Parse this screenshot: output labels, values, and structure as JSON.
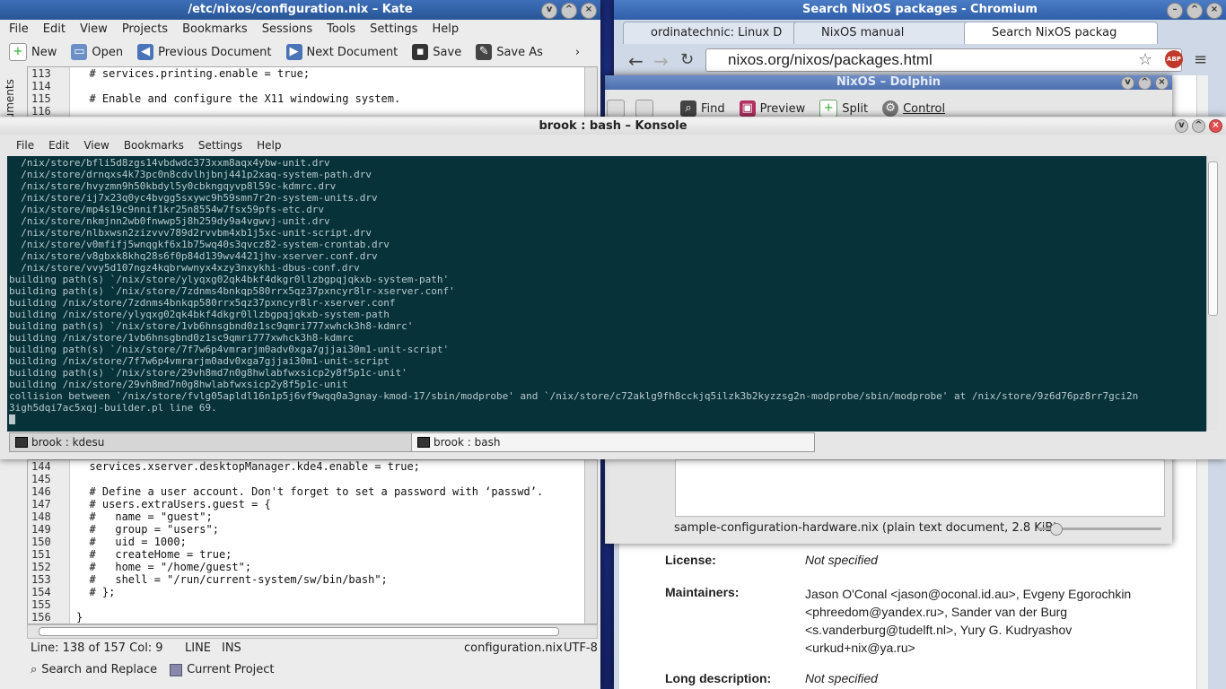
{
  "kate": {
    "title": "/etc/nixos/configuration.nix – Kate",
    "menu": [
      "File",
      "Edit",
      "View",
      "Projects",
      "Bookmarks",
      "Sessions",
      "Tools",
      "Settings",
      "Help"
    ],
    "toolbar": {
      "new": "New",
      "open": "Open",
      "prev": "Previous Document",
      "next": "Next Document",
      "save": "Save",
      "saveas": "Save As"
    },
    "side_label": "cuments",
    "top_lines": [
      {
        "n": "113",
        "t": "  # services.printing.enable = true;"
      },
      {
        "n": "114",
        "t": ""
      },
      {
        "n": "115",
        "t": "  # Enable and configure the X11 windowing system."
      },
      {
        "n": "116",
        "t": ""
      }
    ],
    "bottom_lines": [
      {
        "n": "144",
        "t": "  services.xserver.desktopManager.kde4.enable = true;"
      },
      {
        "n": "145",
        "t": ""
      },
      {
        "n": "146",
        "t": "  # Define a user account. Don't forget to set a password with ‘passwd’."
      },
      {
        "n": "147",
        "t": "  # users.extraUsers.guest = {"
      },
      {
        "n": "148",
        "t": "  #   name = \"guest\";"
      },
      {
        "n": "149",
        "t": "  #   group = \"users\";"
      },
      {
        "n": "150",
        "t": "  #   uid = 1000;"
      },
      {
        "n": "151",
        "t": "  #   createHome = true;"
      },
      {
        "n": "152",
        "t": "  #   home = \"/home/guest\";"
      },
      {
        "n": "153",
        "t": "  #   shell = \"/run/current-system/sw/bin/bash\";"
      },
      {
        "n": "154",
        "t": "  # };"
      },
      {
        "n": "155",
        "t": ""
      },
      {
        "n": "156",
        "t": "}"
      }
    ],
    "status": {
      "pos": "Line: 138 of 157 Col: 9",
      "mode": "LINE",
      "ins": "INS",
      "file": "configuration.nix",
      "enc": "UTF-8"
    },
    "bottom_tabs": {
      "search": "Search and Replace",
      "project": "Current Project"
    }
  },
  "chrome": {
    "title": "Search NixOS packages - Chromium",
    "tabs": [
      "ordinatechnic: Linux D",
      "NixOS manual",
      "Search NixOS packag"
    ],
    "url": "nixos.org/nixos/packages.html",
    "abp": "ABP",
    "license_label": "License:",
    "license_value": "Not specified",
    "maintainers_label": "Maintainers:",
    "maintainers": [
      "Jason O'Conal <jason@oconal.id.au>, Evgeny Egorochkin",
      "<phreedom@yandex.ru>, Sander van der Burg",
      "<s.vanderburg@tudelft.nl>, Yury G. Kudryashov",
      "<urkud+nix@ya.ru>"
    ],
    "longdesc_label": "Long description:",
    "longdesc_value": "Not specified"
  },
  "dolphin": {
    "title": "NixOS – Dolphin",
    "toolbar": {
      "find": "Find",
      "preview": "Preview",
      "split": "Split",
      "control": "Control"
    },
    "status": "sample-configuration-hardware.nix (plain text document, 2.8 KiB)"
  },
  "konsole": {
    "title": "brook : bash – Konsole",
    "menu": [
      "File",
      "Edit",
      "View",
      "Bookmarks",
      "Settings",
      "Help"
    ],
    "lines": [
      "  /nix/store/bfli5d8zgs14vbdwdc373xxm8aqx4ybw-unit.drv",
      "  /nix/store/drnqxs4k73pc0n8cdvlhjbnj441p2xaq-system-path.drv",
      "  /nix/store/hvyzmn9h50kbdyl5y0cbkngqyvp8l59c-kdmrc.drv",
      "  /nix/store/ij7x23q0yc4bvgg5sxywc9h59smn7r2n-system-units.drv",
      "  /nix/store/mp4s19c9nnif1kr25n8554w7fsx59pfs-etc.drv",
      "  /nix/store/nkmjnn2wb0fnwwp5j8h259dy9a4vgwvj-unit.drv",
      "  /nix/store/nlbxwsn2zizvvv789d2rvvbm4xb1j5xc-unit-script.drv",
      "  /nix/store/v0mfifj5wnqgkf6x1b75wq40s3qvcz82-system-crontab.drv",
      "  /nix/store/v8gbxk8khq28s6f0p84d139wv4421jhv-xserver.conf.drv",
      "  /nix/store/vvy5d107ngz4kqbrwwnyx4xzy3nxykhi-dbus-conf.drv",
      "building path(s) `/nix/store/ylyqxg02qk4bkf4dkgr0llzbgpqjqkxb-system-path'",
      "building path(s) `/nix/store/7zdnms4bnkqp580rrx5qz37pxncyr8lr-xserver.conf'",
      "building /nix/store/7zdnms4bnkqp580rrx5qz37pxncyr8lr-xserver.conf",
      "building /nix/store/ylyqxg02qk4bkf4dkgr0llzbgpqjqkxb-system-path",
      "building path(s) `/nix/store/1vb6hnsgbnd0z1sc9qmri777xwhck3h8-kdmrc'",
      "building /nix/store/1vb6hnsgbnd0z1sc9qmri777xwhck3h8-kdmrc",
      "building path(s) `/nix/store/7f7w6p4vmrarjm0adv0xga7gjjai30m1-unit-script'",
      "building /nix/store/7f7w6p4vmrarjm0adv0xga7gjjai30m1-unit-script",
      "building path(s) `/nix/store/29vh8md7n0g8hwlabfwxsicp2y8f5p1c-unit'",
      "building /nix/store/29vh8md7n0g8hwlabfwxsicp2y8f5p1c-unit",
      "collision between `/nix/store/fvlg05apldl16n1p5j6vf9wqq0a3gnay-kmod-17/sbin/modprobe' and `/nix/store/c72aklg9fh8cckjq5ilzk3b2kyzzsg2n-modprobe/sbin/modprobe' at /nix/store/9z6d76pz8rr7gci2n",
      "3igh5dqi7ac5xqj-builder.pl line 69."
    ],
    "tabs": [
      "brook : kdesu",
      "brook : bash"
    ]
  }
}
